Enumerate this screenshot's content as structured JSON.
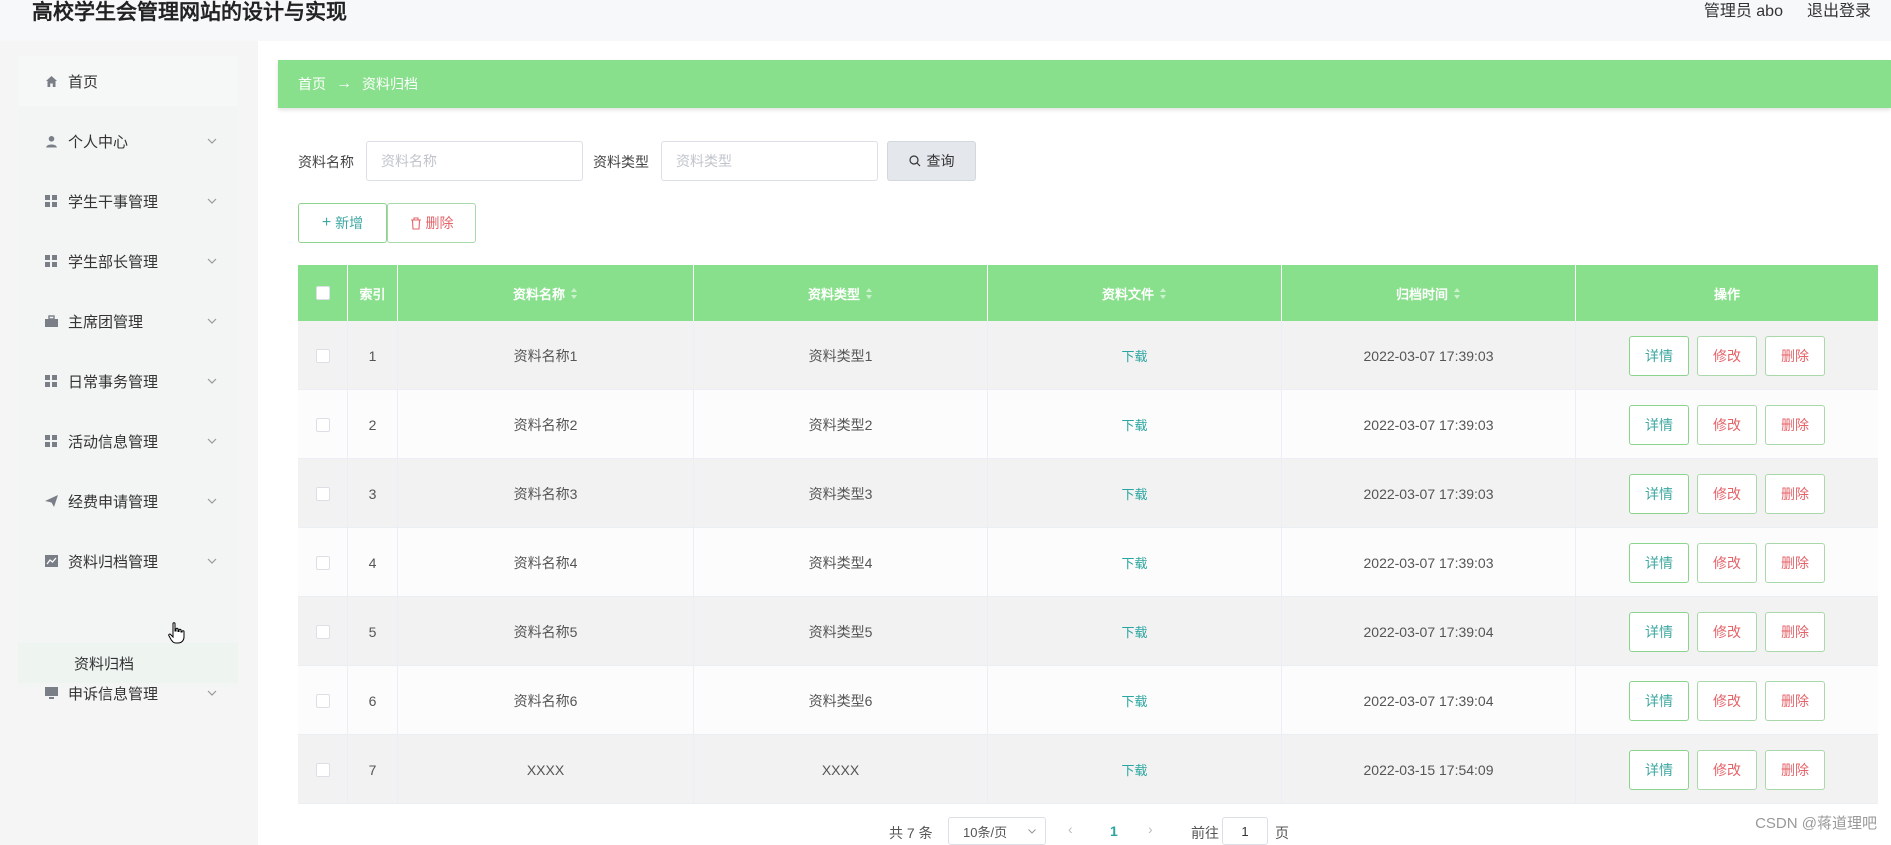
{
  "app": {
    "title": "高校学生会管理网站的设计与实现"
  },
  "header": {
    "user": "管理员 abo",
    "logout": "退出登录"
  },
  "sidebar": {
    "items": [
      {
        "label": "首页",
        "icon": "home-icon"
      },
      {
        "label": "个人中心",
        "icon": "user-icon"
      },
      {
        "label": "学生干事管理",
        "icon": "grid-icon"
      },
      {
        "label": "学生部长管理",
        "icon": "grid-icon"
      },
      {
        "label": "主席团管理",
        "icon": "briefcase-icon"
      },
      {
        "label": "日常事务管理",
        "icon": "grid-icon"
      },
      {
        "label": "活动信息管理",
        "icon": "grid-icon"
      },
      {
        "label": "经费申请管理",
        "icon": "send-icon"
      },
      {
        "label": "资料归档管理",
        "icon": "chart-icon"
      },
      {
        "label": "申诉信息管理",
        "icon": "monitor-icon"
      }
    ],
    "submenu": {
      "label": "资料归档"
    }
  },
  "breadcrumb": {
    "home": "首页",
    "current": "资料归档"
  },
  "search": {
    "name_label": "资料名称",
    "name_placeholder": "资料名称",
    "type_label": "资料类型",
    "type_placeholder": "资料类型",
    "query_label": "查询"
  },
  "actions": {
    "add_label": "新增",
    "delete_label": "删除"
  },
  "table": {
    "headers": {
      "index": "索引",
      "name": "资料名称",
      "type": "资料类型",
      "file": "资料文件",
      "time": "归档时间",
      "ops": "操作"
    },
    "rows": [
      {
        "index": "1",
        "name": "资料名称1",
        "type": "资料类型1",
        "file": "下载",
        "time": "2022-03-07 17:39:03"
      },
      {
        "index": "2",
        "name": "资料名称2",
        "type": "资料类型2",
        "file": "下载",
        "time": "2022-03-07 17:39:03"
      },
      {
        "index": "3",
        "name": "资料名称3",
        "type": "资料类型3",
        "file": "下载",
        "time": "2022-03-07 17:39:03"
      },
      {
        "index": "4",
        "name": "资料名称4",
        "type": "资料类型4",
        "file": "下载",
        "time": "2022-03-07 17:39:03"
      },
      {
        "index": "5",
        "name": "资料名称5",
        "type": "资料类型5",
        "file": "下载",
        "time": "2022-03-07 17:39:04"
      },
      {
        "index": "6",
        "name": "资料名称6",
        "type": "资料类型6",
        "file": "下载",
        "time": "2022-03-07 17:39:04"
      },
      {
        "index": "7",
        "name": "XXXX",
        "type": "XXXX",
        "file": "下载",
        "time": "2022-03-15 17:54:09"
      }
    ],
    "row_buttons": {
      "detail": "详情",
      "edit": "修改",
      "delete": "删除"
    }
  },
  "pagination": {
    "total": "共 7 条",
    "page_size": "10条/页",
    "current_page": "1",
    "goto_label": "前往",
    "goto_value": "1",
    "page_suffix": "页"
  },
  "watermark": "CSDN @蒋道理吧",
  "colors": {
    "accent": "#89e08c",
    "link": "#2aa5a0",
    "danger": "#e4646a"
  }
}
